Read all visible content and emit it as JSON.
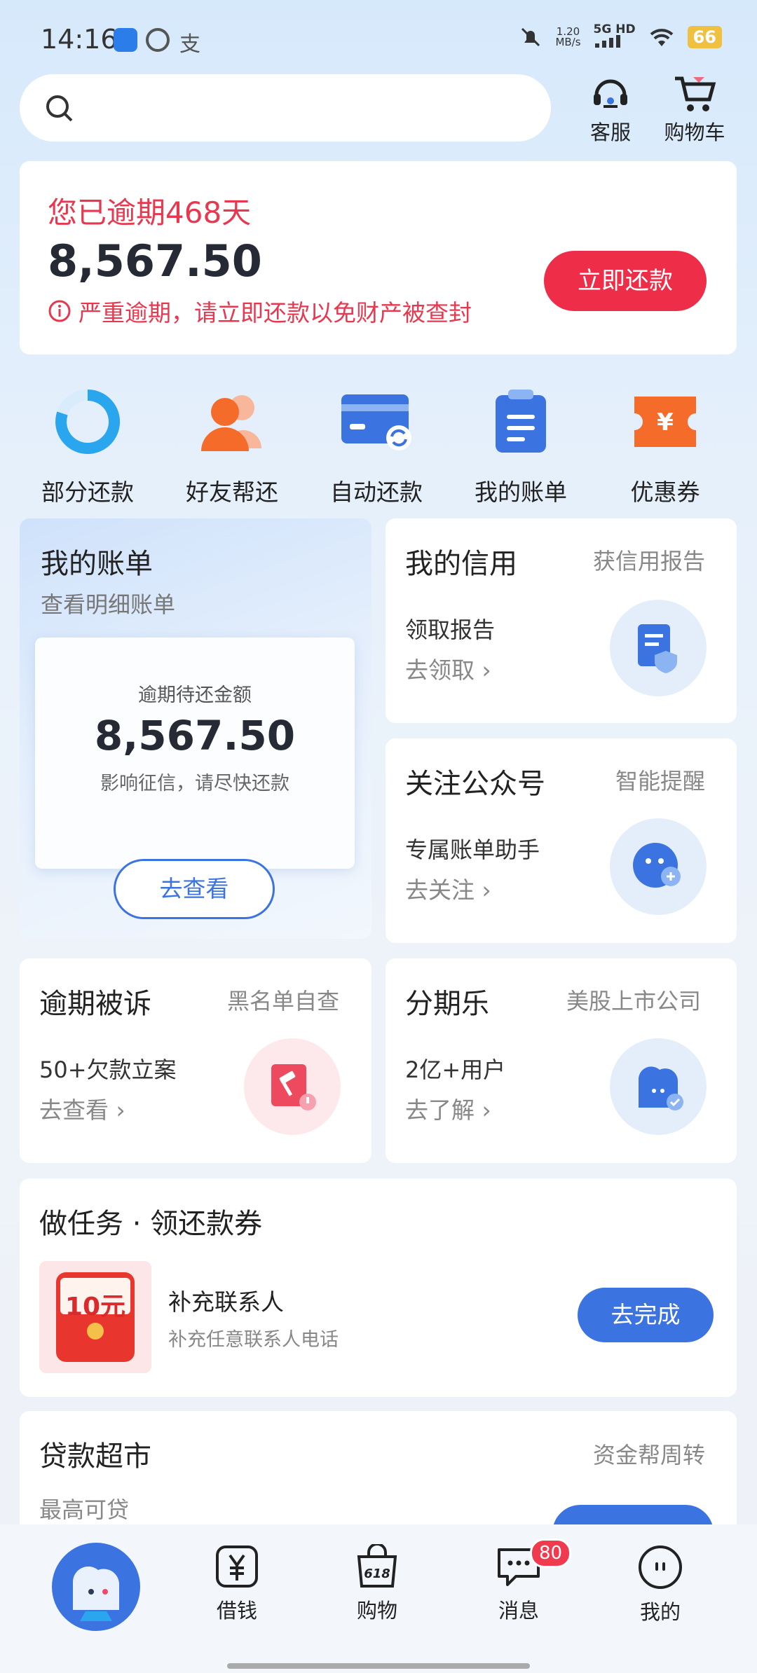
{
  "status_bar": {
    "time": "14:16",
    "net_speed_value": "1.20",
    "net_speed_unit": "MB/s",
    "network": "5G HD",
    "battery": "66"
  },
  "header": {
    "service_label": "客服",
    "cart_label": "购物车"
  },
  "overdue": {
    "title": "您已逾期468天",
    "amount": "8,567.50",
    "warning": "严重逾期，请立即还款以免财产被查封",
    "pay_button": "立即还款"
  },
  "quick_actions": [
    {
      "label": "部分还款",
      "icon": "partial-repay-icon"
    },
    {
      "label": "好友帮还",
      "icon": "friends-help-icon"
    },
    {
      "label": "自动还款",
      "icon": "auto-repay-card-icon"
    },
    {
      "label": "我的账单",
      "icon": "bill-clipboard-icon"
    },
    {
      "label": "优惠券",
      "icon": "coupon-icon"
    }
  ],
  "bill_tile": {
    "title": "我的账单",
    "subtitle": "查看明细账单",
    "inner_label": "逾期待还金额",
    "inner_amount": "8,567.50",
    "inner_note": "影响征信，请尽快还款",
    "button": "去查看"
  },
  "credit_tile": {
    "title": "我的信用",
    "right": "获信用报告",
    "line1": "领取报告",
    "line2": "去领取"
  },
  "wechat_tile": {
    "title": "关注公众号",
    "right": "智能提醒",
    "line1": "专属账单助手",
    "line2": "去关注"
  },
  "lawsuit_tile": {
    "title": "逾期被诉",
    "right": "黑名单自查",
    "line1": "50+欠款立案",
    "line2": "去查看"
  },
  "fenqile_tile": {
    "title": "分期乐",
    "right": "美股上市公司",
    "line1": "2亿+用户",
    "line2": "去了解"
  },
  "task": {
    "title": "做任务 · 领还款券",
    "coupon_value": "10元",
    "name": "补充联系人",
    "desc": "补充任意联系人电话",
    "button": "去完成"
  },
  "loan_market": {
    "title": "贷款超市",
    "right": "资金帮周转",
    "line1": "最高可贷"
  },
  "nav": {
    "items": [
      "借钱",
      "购物",
      "消息",
      "我的"
    ],
    "message_badge": "80"
  },
  "colors": {
    "accent_red": "#ee2d48",
    "accent_blue": "#3b74e0",
    "orange": "#f46b2a"
  }
}
